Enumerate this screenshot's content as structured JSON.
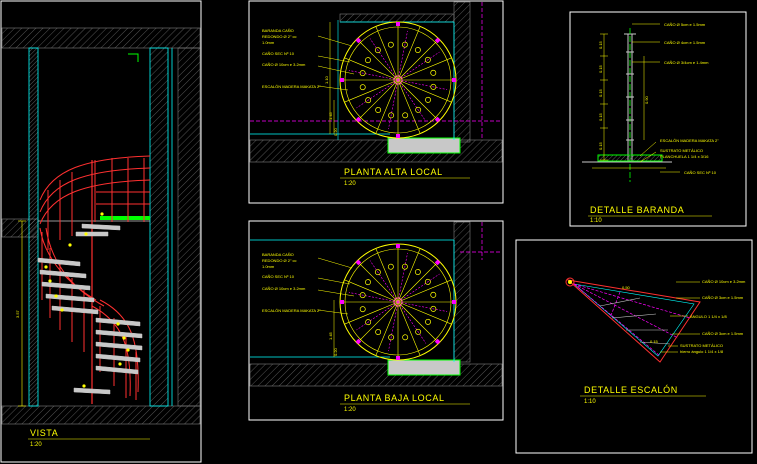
{
  "colors": {
    "background": "#000000",
    "frame": "#ffffff",
    "text": "#ffff00",
    "wall": "#00ffff",
    "railing": "#ff3030",
    "step": "#c8c8c8",
    "landing": "#00ff00",
    "circle": "#ffff00",
    "bolt": "#ff00ff",
    "hatch": "#808080"
  },
  "vista": {
    "title": "VISTA",
    "scale": "1:20",
    "dimension": "3.57"
  },
  "planta_alta": {
    "title": "PLANTA ALTA LOCAL",
    "scale": "1:20",
    "notes": [
      "BARANDA CAÑO",
      "REDONDO Ø 2\" cc",
      "1.0mm",
      "CAÑO SEC Nº 10",
      "CAÑO Ø 10cm e 3.2mm",
      "ESCALÓN MADERA MAKATA 2\""
    ],
    "dimensions": [
      "1.10",
      "1.45",
      "0.20"
    ]
  },
  "planta_baja": {
    "title": "PLANTA BAJA LOCAL",
    "scale": "1:20",
    "notes": [
      "BARANDA CAÑO",
      "REDONDO Ø 2\" cc",
      "1.0mm",
      "CAÑO SEC Nº 10",
      "CAÑO Ø 10cm e 3.2mm",
      "ESCALÓN MADERA MAKATA 2\""
    ],
    "dimensions": [
      "1.45",
      "0.20"
    ]
  },
  "detalle_baranda": {
    "title": "DETALLE BARANDA",
    "scale": "1:10",
    "notes": [
      "CAÑO Ø 5cm e 1.5mm",
      "CAÑO Ø 4cm e 1.5mm",
      "CAÑO Ø 3/4cm e 1.4mm",
      "ESCALÓN MADERA MAKATA 2\"",
      "SUSTRATO METÁLICO",
      "PLANCHUELA 1 1/4 x 3/16",
      "CAÑO SEC Nº 10"
    ],
    "dimensions": [
      "0.15",
      "0.15",
      "0.15",
      "0.15",
      "0.15",
      "0.90"
    ]
  },
  "detalle_escalon": {
    "title": "DETALLE ESCALÓN",
    "scale": "1:10",
    "notes": [
      "CAÑO Ø 10cm e 3.2mm",
      "CAÑO Ø 3cm e 1.5mm",
      "ÁNGULO 1 1/4 x 1/8",
      "CAÑO Ø 3cm e 1.5mm",
      "SUSTRATO METÁLICO",
      "hierro ángulo 1 1/4 x 1/8"
    ],
    "dimensions": [
      "0.50",
      "0.15"
    ]
  }
}
